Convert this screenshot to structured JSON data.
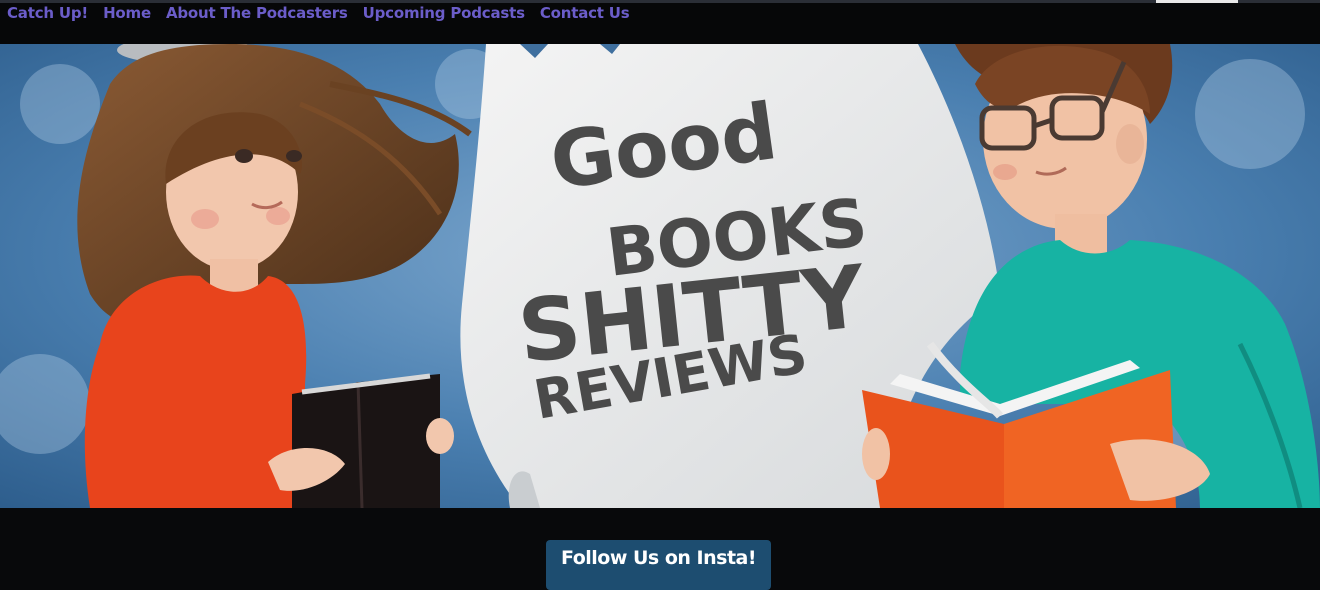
{
  "nav": {
    "items": [
      {
        "label": "Catch Up!"
      },
      {
        "label": "Home"
      },
      {
        "label": "About The Podcasters"
      },
      {
        "label": "Upcoming Podcasts"
      },
      {
        "label": "Contact Us"
      }
    ]
  },
  "hero": {
    "banner": {
      "line1": "Good",
      "line2": "BOOKS",
      "line3": "SHITTY",
      "line4": "REVIEWS"
    }
  },
  "cta": {
    "label": "Follow Us on Insta!"
  },
  "colors": {
    "nav_link": "#6b5dc9",
    "button_bg": "#1d4d70",
    "page_bg": "#08090b"
  }
}
